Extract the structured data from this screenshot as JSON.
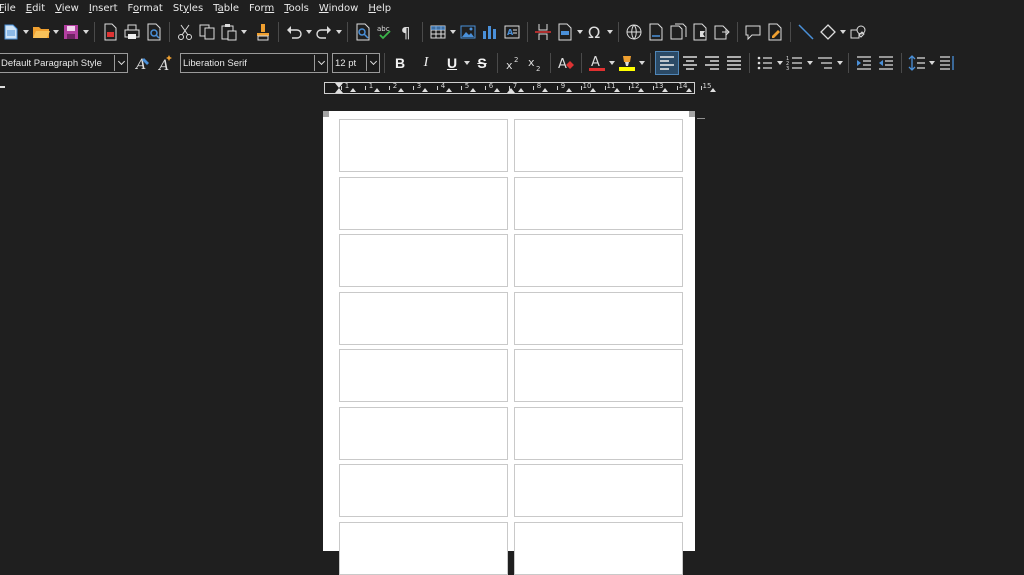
{
  "menubar": {
    "items": [
      {
        "label": "File",
        "mnemonic": "F",
        "rest": "ile"
      },
      {
        "label": "Edit",
        "mnemonic": "E",
        "rest": "dit"
      },
      {
        "label": "View",
        "mnemonic": "V",
        "rest": "iew"
      },
      {
        "label": "Insert",
        "mnemonic": "I",
        "rest": "nsert"
      },
      {
        "label": "Format",
        "mnemonic": "o",
        "pre": "F",
        "rest": "rmat"
      },
      {
        "label": "Styles",
        "mnemonic": "y",
        "pre": "St",
        "rest": "les"
      },
      {
        "label": "Table",
        "mnemonic": "a",
        "pre": "T",
        "rest": "ble"
      },
      {
        "label": "Form",
        "mnemonic": "m",
        "pre": "For",
        "rest": ""
      },
      {
        "label": "Tools",
        "mnemonic": "T",
        "rest": "ools"
      },
      {
        "label": "Window",
        "mnemonic": "W",
        "rest": "indow"
      },
      {
        "label": "Help",
        "mnemonic": "H",
        "rest": "elp"
      }
    ]
  },
  "standard_toolbar": {
    "icons": [
      "new-icon",
      "open-icon",
      "save-icon",
      "export-pdf-icon",
      "print-icon",
      "print-preview-icon",
      "cut-icon",
      "copy-icon",
      "paste-icon",
      "clone-formatting-icon",
      "undo-icon",
      "redo-icon",
      "find-replace-icon",
      "spelling-icon",
      "formatting-marks-icon",
      "insert-table-icon",
      "insert-image-icon",
      "insert-chart-icon",
      "insert-textbox-icon",
      "page-break-icon",
      "insert-field-icon",
      "special-character-icon",
      "hyperlink-icon",
      "footnote-icon",
      "endnote-icon",
      "bookmark-icon",
      "cross-reference-icon",
      "comment-icon",
      "track-changes-icon",
      "line-icon",
      "basic-shapes-icon",
      "draw-functions-icon"
    ]
  },
  "formatting_toolbar": {
    "paragraph_style": "Default Paragraph Style",
    "font_name": "Liberation Serif",
    "font_size": "12 pt",
    "bold": "B",
    "italic": "I",
    "underline": "U",
    "strikethrough": "S",
    "font_color": "#e03030",
    "highlight_color": "#ffff00",
    "active_alignment": "align-left"
  },
  "ruler": {
    "numbers": [
      "1",
      "1",
      "2",
      "3",
      "4",
      "5",
      "6",
      "7",
      "8",
      "9",
      "10",
      "11",
      "12",
      "13",
      "14",
      "15"
    ]
  },
  "document": {
    "label_grid": {
      "columns": 2,
      "visible_rows": 8
    }
  }
}
